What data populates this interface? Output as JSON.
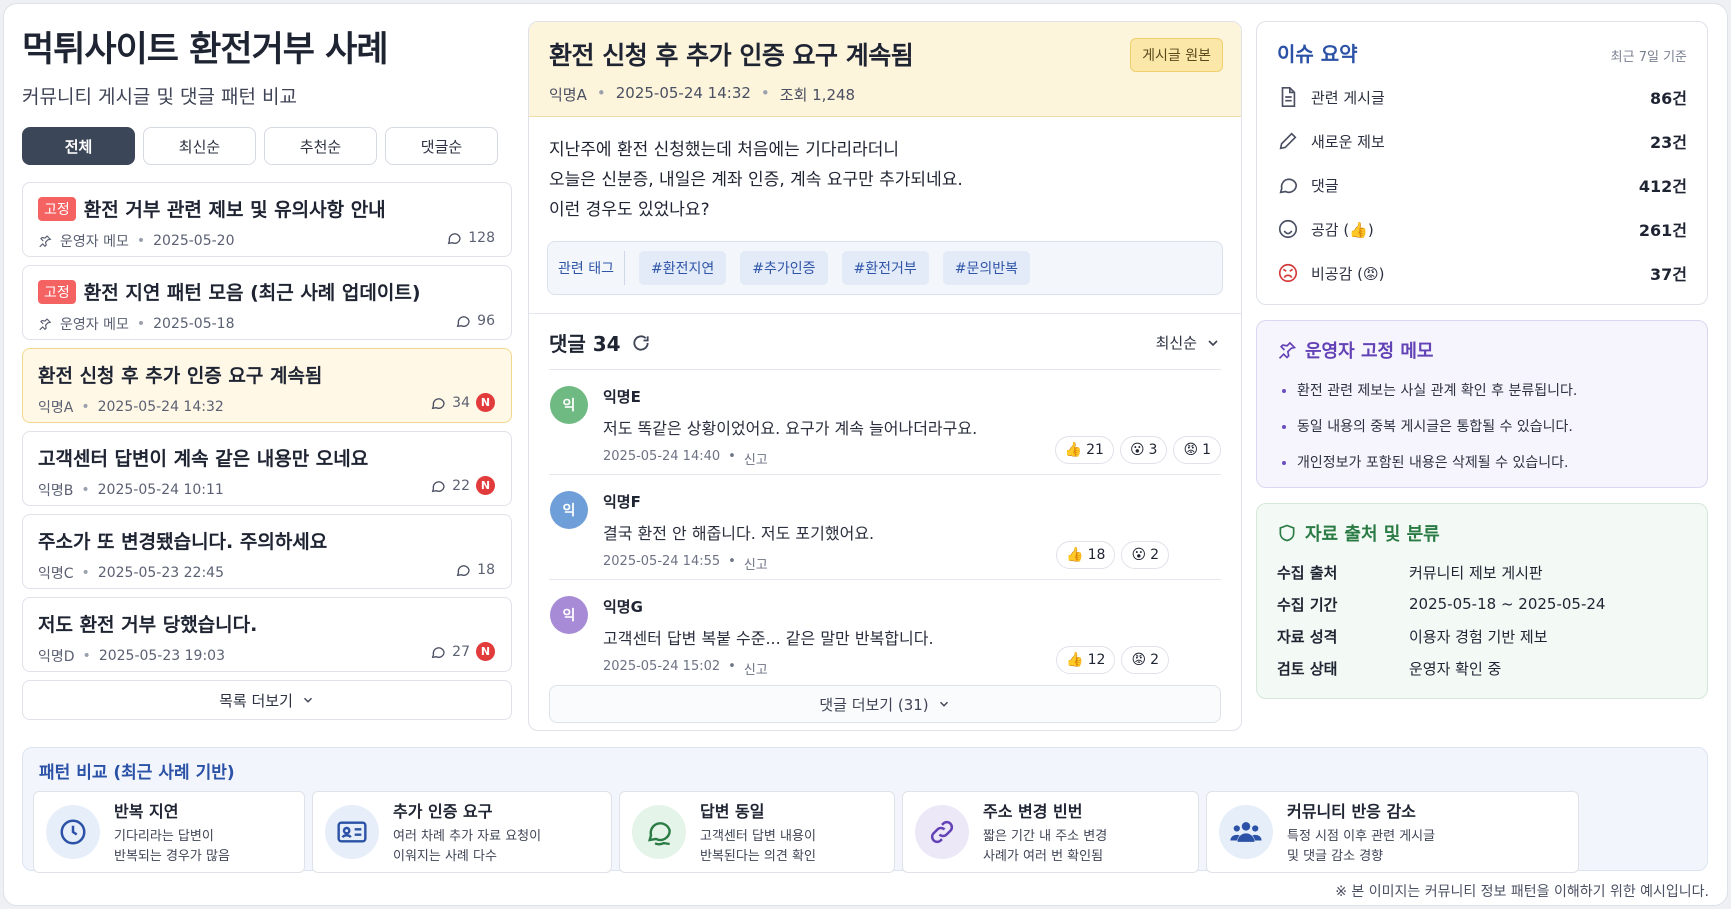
{
  "header": {
    "title": "먹튀사이트 환전거부 사례",
    "subtitle": "커뮤니티 게시글 및 댓글 패턴 비교"
  },
  "tabs": [
    {
      "label": "전체"
    },
    {
      "label": "최신순"
    },
    {
      "label": "추천순"
    },
    {
      "label": "댓글순"
    }
  ],
  "posts": [
    {
      "badge": "고정",
      "title": "환전 거부 관련 제보 및 유의사항 안내",
      "author": "운영자 메모",
      "date": "2025-05-20",
      "comments": "128"
    },
    {
      "badge": "고정",
      "title": "환전 지연 패턴 모음 (최근 사례 업데이트)",
      "author": "운영자 메모",
      "date": "2025-05-18",
      "comments": "96"
    },
    {
      "title": "환전 신청 후 추가 인증 요구 계속됨",
      "author": "익명A",
      "date": "2025-05-24 14:32",
      "comments": "34",
      "new": "N"
    },
    {
      "title": "고객센터 답변이 계속 같은 내용만 오네요",
      "author": "익명B",
      "date": "2025-05-24 10:11",
      "comments": "22",
      "new": "N"
    },
    {
      "title": "주소가 또 변경됐습니다. 주의하세요",
      "author": "익명C",
      "date": "2025-05-23 22:45",
      "comments": "18"
    },
    {
      "title": "저도 환전 거부 당했습니다.",
      "author": "익명D",
      "date": "2025-05-23 19:03",
      "comments": "27",
      "new": "N"
    }
  ],
  "list_more": "목록 더보기",
  "article": {
    "title": "환전 신청 후 추가 인증 요구 계속됨",
    "original_button": "게시글 원본",
    "author": "익명A",
    "date": "2025-05-24 14:32",
    "views": "조회 1,248",
    "body": [
      "지난주에 환전 신청했는데 처음에는 기다리라더니",
      "오늘은 신분증, 내일은 계좌 인증, 계속 요구만 추가되네요.",
      "이런 경우도 있었나요?"
    ],
    "tag_label": "관련 태그",
    "tags": [
      "#환전지연",
      "#추가인증",
      "#환전거부",
      "#문의반복"
    ]
  },
  "comments_section": {
    "title": "댓글 34",
    "sort": "최신순",
    "more": "댓글 더보기 (31)",
    "items": [
      {
        "avatar": "익",
        "author": "익명E",
        "text": "저도 똑같은 상황이었어요. 요구가 계속 늘어나더라구요.",
        "date": "2025-05-24 14:40",
        "report": "신고",
        "reactions": [
          {
            "emoji": "👍",
            "count": "21"
          },
          {
            "emoji": "😮",
            "count": "3"
          },
          {
            "emoji": "😡",
            "count": "1"
          }
        ]
      },
      {
        "avatar": "익",
        "author": "익명F",
        "text": "결국 환전 안 해줍니다. 저도 포기했어요.",
        "date": "2025-05-24 14:55",
        "report": "신고",
        "reactions": [
          {
            "emoji": "👍",
            "count": "18"
          },
          {
            "emoji": "😮",
            "count": "2"
          }
        ]
      },
      {
        "avatar": "익",
        "author": "익명G",
        "text": "고객센터 답변 복붙 수준... 같은 말만 반복합니다.",
        "date": "2025-05-24 15:02",
        "report": "신고",
        "reactions": [
          {
            "emoji": "👍",
            "count": "12"
          },
          {
            "emoji": "😡",
            "count": "2"
          }
        ]
      }
    ]
  },
  "summary": {
    "title": "이슈 요약",
    "note": "최근 7일 기준",
    "rows": [
      {
        "icon": "document-icon",
        "label": "관련 게시글",
        "value": "86건"
      },
      {
        "icon": "pencil-icon",
        "label": "새로운 제보",
        "value": "23건"
      },
      {
        "icon": "chat-icon",
        "label": "댓글",
        "value": "412건"
      },
      {
        "icon": "smile-icon",
        "label": "공감 (👍)",
        "value": "261건"
      },
      {
        "icon": "angry-icon",
        "label": "비공감 (😡)",
        "value": "37건"
      }
    ]
  },
  "memo": {
    "title": "운영자 고정 메모",
    "items": [
      "환전 관련 제보는 사실 관계 확인 후 분류됩니다.",
      "동일 내용의 중복 게시글은 통합될 수 있습니다.",
      "개인정보가 포함된 내용은 삭제될 수 있습니다."
    ]
  },
  "source": {
    "title": "자료 출처 및 분류",
    "rows": [
      {
        "key": "수집 출처",
        "value": "커뮤니티 제보 게시판"
      },
      {
        "key": "수집 기간",
        "value": "2025-05-18 ~ 2025-05-24"
      },
      {
        "key": "자료 성격",
        "value": "이용자 경험 기반 제보"
      },
      {
        "key": "검토 상태",
        "value": "운영자 확인 중"
      }
    ]
  },
  "patterns": {
    "title": "패턴 비교 (최근 사례 기반)",
    "items": [
      {
        "icon": "clock-icon",
        "title": "반복 지연",
        "desc1": "기다리라는 답변이",
        "desc2": "반복되는 경우가 많음"
      },
      {
        "icon": "id-card-icon",
        "title": "추가 인증 요구",
        "desc1": "여러 차례 추가 자료 요청이",
        "desc2": "이워지는 사례 다수"
      },
      {
        "icon": "chat-bubbles-icon",
        "title": "답변 동일",
        "desc1": "고객센터 답변 내용이",
        "desc2": "반복된다는 의견 확인"
      },
      {
        "icon": "link-icon",
        "title": "주소 변경 빈번",
        "desc1": "짧은 기간 내 주소 변경",
        "desc2": "사례가 여러 번 확인됨"
      },
      {
        "icon": "users-icon",
        "title": "커뮤니티 반응 감소",
        "desc1": "특정 시점 이후 관련 게시글",
        "desc2": "및 댓글 감소 경향"
      }
    ]
  },
  "footnote": "※ 본 이미지는 커뮤니티 정보 패턴을 이해하기 위한 예시입니다.",
  "colors": {
    "accent_blue": "#2b52a6",
    "memo_purple": "#6342b6",
    "source_green": "#2b7b45",
    "highlight": "#fff8e6",
    "badge_red": "#f46262"
  }
}
